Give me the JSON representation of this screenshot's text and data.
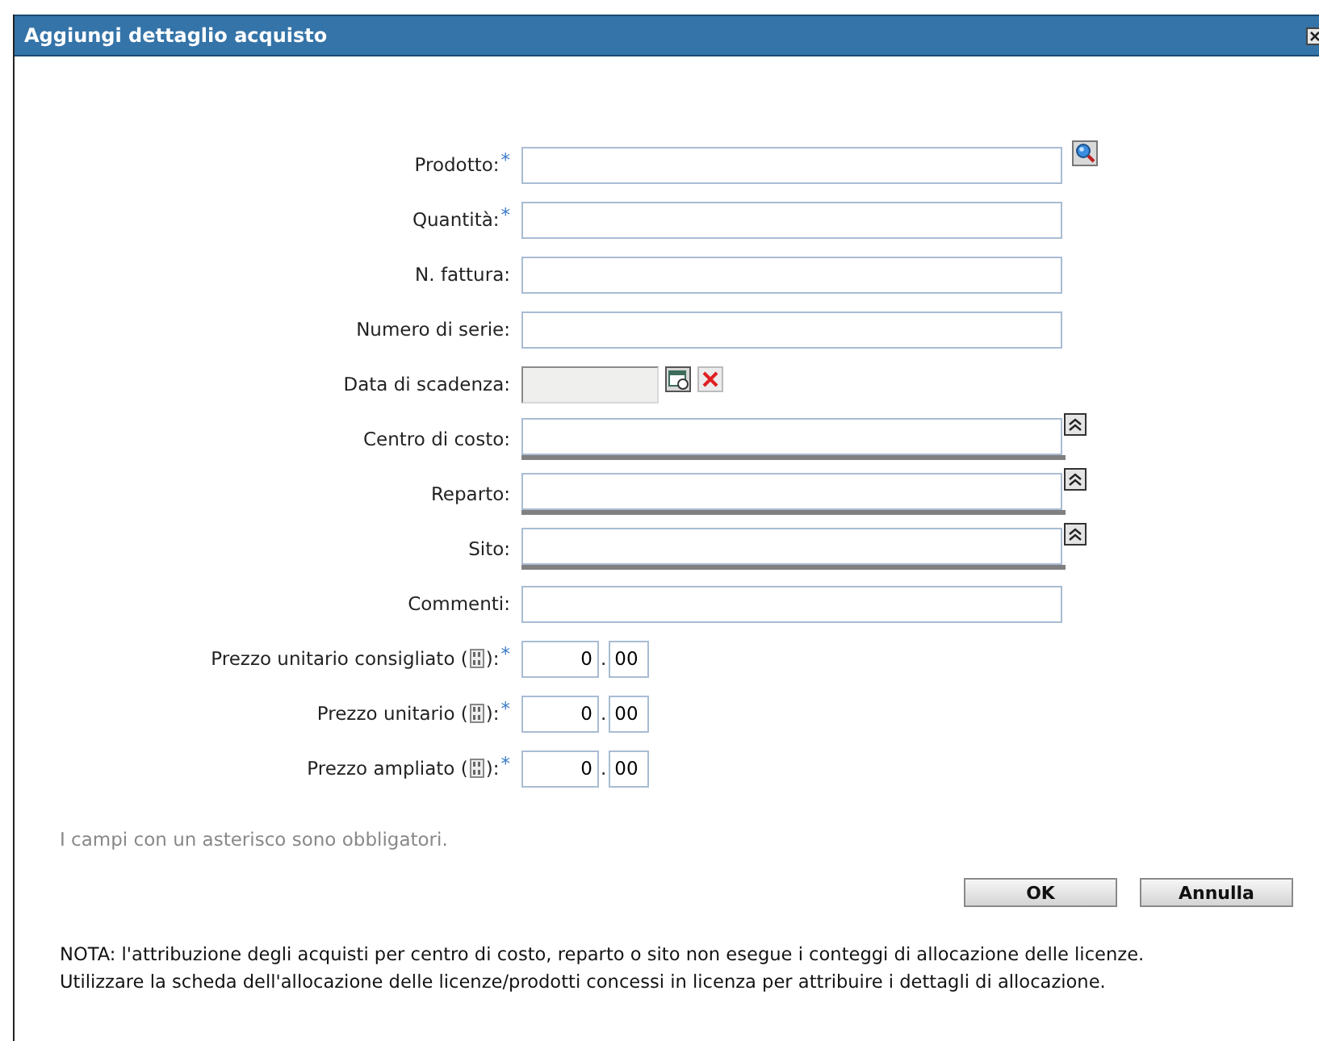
{
  "window": {
    "title": "Aggiungi dettaglio acquisto"
  },
  "form": {
    "required_mark": "*",
    "fields": [
      {
        "kind": "search",
        "label": "Prodotto:",
        "required": true
      },
      {
        "kind": "text",
        "label": "Quantità:",
        "required": true
      },
      {
        "kind": "text",
        "label": "N. fattura:",
        "required": false
      },
      {
        "kind": "text",
        "label": "Numero di serie:",
        "required": false
      },
      {
        "kind": "date",
        "label": "Data di scadenza:",
        "required": false,
        "disabled": true
      },
      {
        "kind": "picker",
        "label": "Centro di costo:",
        "required": false
      },
      {
        "kind": "picker",
        "label": "Reparto:",
        "required": false
      },
      {
        "kind": "picker",
        "label": "Sito:",
        "required": false
      },
      {
        "kind": "text",
        "label": "Commenti:",
        "required": false
      },
      {
        "kind": "price",
        "label": "Prezzo unitario consigliato (",
        "label_end": "):",
        "required": true,
        "integer": "0",
        "separator": ".",
        "decimal": "00"
      },
      {
        "kind": "price",
        "label": "Prezzo unitario (",
        "label_end": "):",
        "required": true,
        "integer": "0",
        "separator": ".",
        "decimal": "00"
      },
      {
        "kind": "price",
        "label": "Prezzo ampliato (",
        "label_end": "):",
        "required": true,
        "integer": "0",
        "separator": ".",
        "decimal": "00"
      }
    ]
  },
  "required_note": "I campi con un asterisco sono obbligatori.",
  "buttons": [
    {
      "label": "OK"
    },
    {
      "label": "Annulla"
    }
  ],
  "note": [
    "NOTA: l'attribuzione degli acquisti per centro di costo, reparto o sito non esegue i conteggi di allocazione delle licenze.",
    "Utilizzare la scheda dell'allocazione delle licenze/prodotti concessi in licenza per attribuire i dettagli di allocazione."
  ]
}
